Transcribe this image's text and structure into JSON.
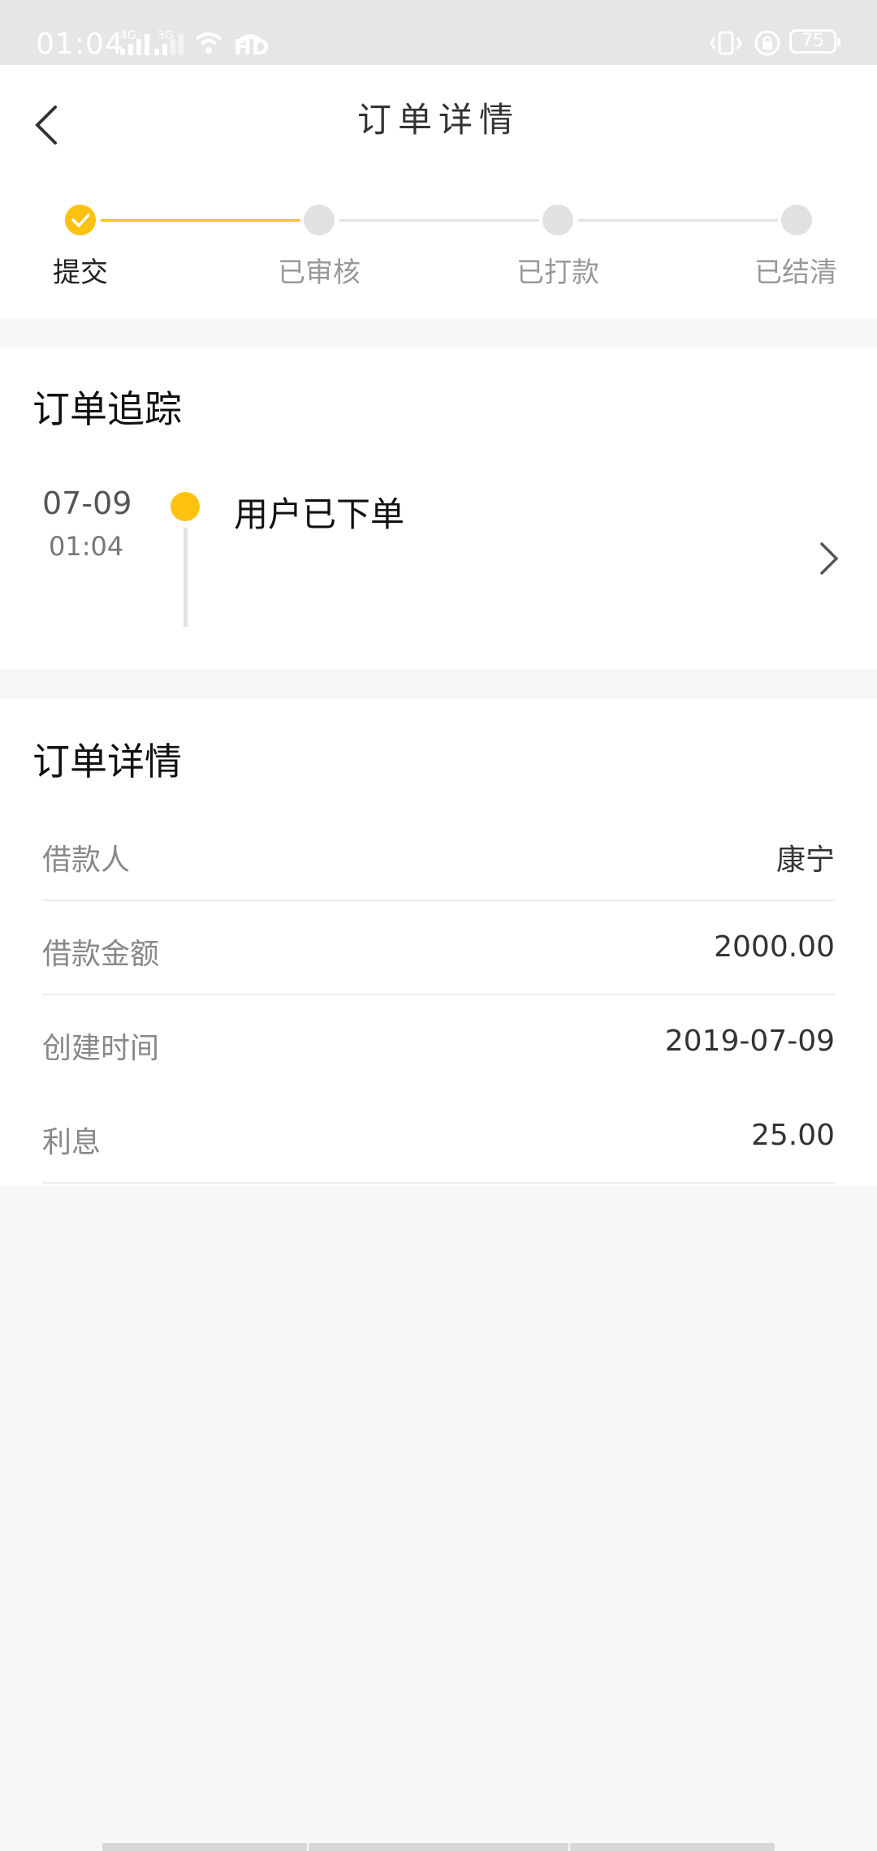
{
  "status_bar": {
    "time": "01:04",
    "net1": "4G",
    "net2": "3G",
    "hd": "HD",
    "battery": "75"
  },
  "header": {
    "title": "订单详情"
  },
  "steps": [
    {
      "label": "提交",
      "done": true
    },
    {
      "label": "已审核",
      "done": false
    },
    {
      "label": "已打款",
      "done": false
    },
    {
      "label": "已结清",
      "done": false
    }
  ],
  "tracking": {
    "title": "订单追踪",
    "date": "07-09",
    "time": "01:04",
    "event": "用户已下单"
  },
  "details": {
    "title": "订单详情",
    "rows": [
      {
        "label": "借款人",
        "value": "康宁"
      },
      {
        "label": "借款金额",
        "value": "2000.00"
      },
      {
        "label": "创建时间",
        "value": "2019-07-09"
      },
      {
        "label": "利息",
        "value": "25.00"
      }
    ]
  },
  "colors": {
    "accent": "#fdc20f",
    "inactive": "#e1e1e1",
    "background": "#f7f7f7"
  }
}
